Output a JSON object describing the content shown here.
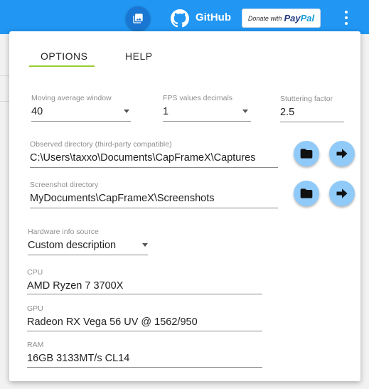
{
  "toolbar": {
    "github_label": "GitHub",
    "paypal_donate": "Donate with",
    "paypal_pay": "Pay",
    "paypal_pal": "Pal",
    "screenshot_icon": "photo-library-icon",
    "github_icon": "github-octocat-icon",
    "menu_icon": "more-vert-icon"
  },
  "tabs": [
    {
      "label": "OPTIONS",
      "active": true
    },
    {
      "label": "HELP",
      "active": false
    }
  ],
  "fields": {
    "moving_average": {
      "label": "Moving average window",
      "value": "40"
    },
    "fps_decimals": {
      "label": "FPS values decimals",
      "value": "1"
    },
    "stuttering": {
      "label": "Stuttering factor",
      "value": "2.5"
    },
    "observed_dir": {
      "label": "Observed directory (third-party compatible)",
      "value": "C:\\Users\\taxxo\\Documents\\CapFrameX\\Captures"
    },
    "screenshot_dir": {
      "label": "Screenshot directory",
      "value": "MyDocuments\\CapFrameX\\Screenshots"
    },
    "hardware_source": {
      "label": "Hardware info source",
      "value": "Custom description"
    },
    "cpu": {
      "label": "CPU",
      "value": "AMD Ryzen 7 3700X"
    },
    "gpu": {
      "label": "GPU",
      "value": "Radeon RX Vega 56 UV @ 1562/950"
    },
    "ram": {
      "label": "RAM",
      "value": "16GB 3133MT/s CL14"
    }
  },
  "colors": {
    "appbar": "#2196f3",
    "accent_indicator": "#9acd32",
    "action_button": "#90caf9"
  }
}
